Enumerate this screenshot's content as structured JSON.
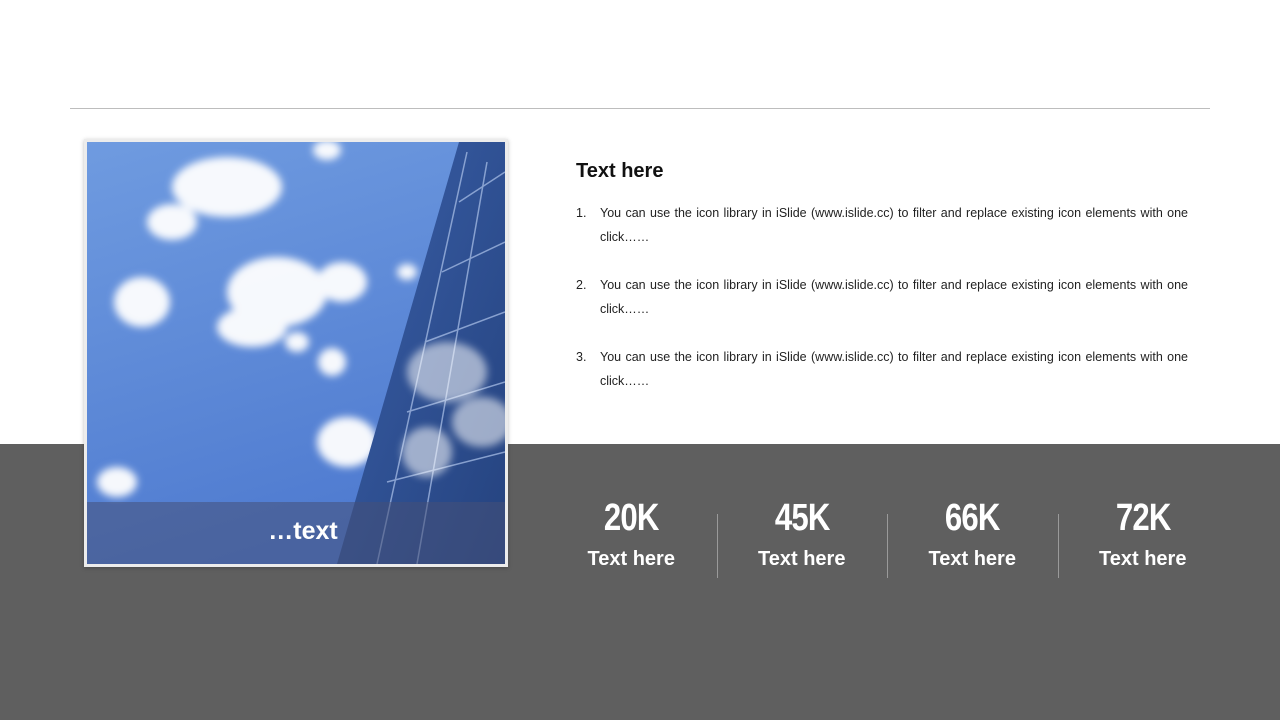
{
  "content": {
    "title": "Text here",
    "items": [
      {
        "number": "1.",
        "text": "You can use the icon library in iSlide  (www.islide.cc) to filter and replace existing icon elements with one click……"
      },
      {
        "number": "2.",
        "text": "You can use the icon library in iSlide  (www.islide.cc) to filter and replace existing icon elements with one click……"
      },
      {
        "number": "3.",
        "text": "You can use the icon library in iSlide  (www.islide.cc) to filter and replace existing icon elements with one click……"
      }
    ]
  },
  "photo": {
    "caption": "…text",
    "sky_color": "#5b86d6",
    "glass_color": "#2e4f8f"
  },
  "stats": [
    {
      "value": "20K",
      "label": "Text here"
    },
    {
      "value": "45K",
      "label": "Text here"
    },
    {
      "value": "66K",
      "label": "Text here"
    },
    {
      "value": "72K",
      "label": "Text here"
    }
  ],
  "colors": {
    "band": "#5f5f5f",
    "rule": "#bdbdbd"
  }
}
